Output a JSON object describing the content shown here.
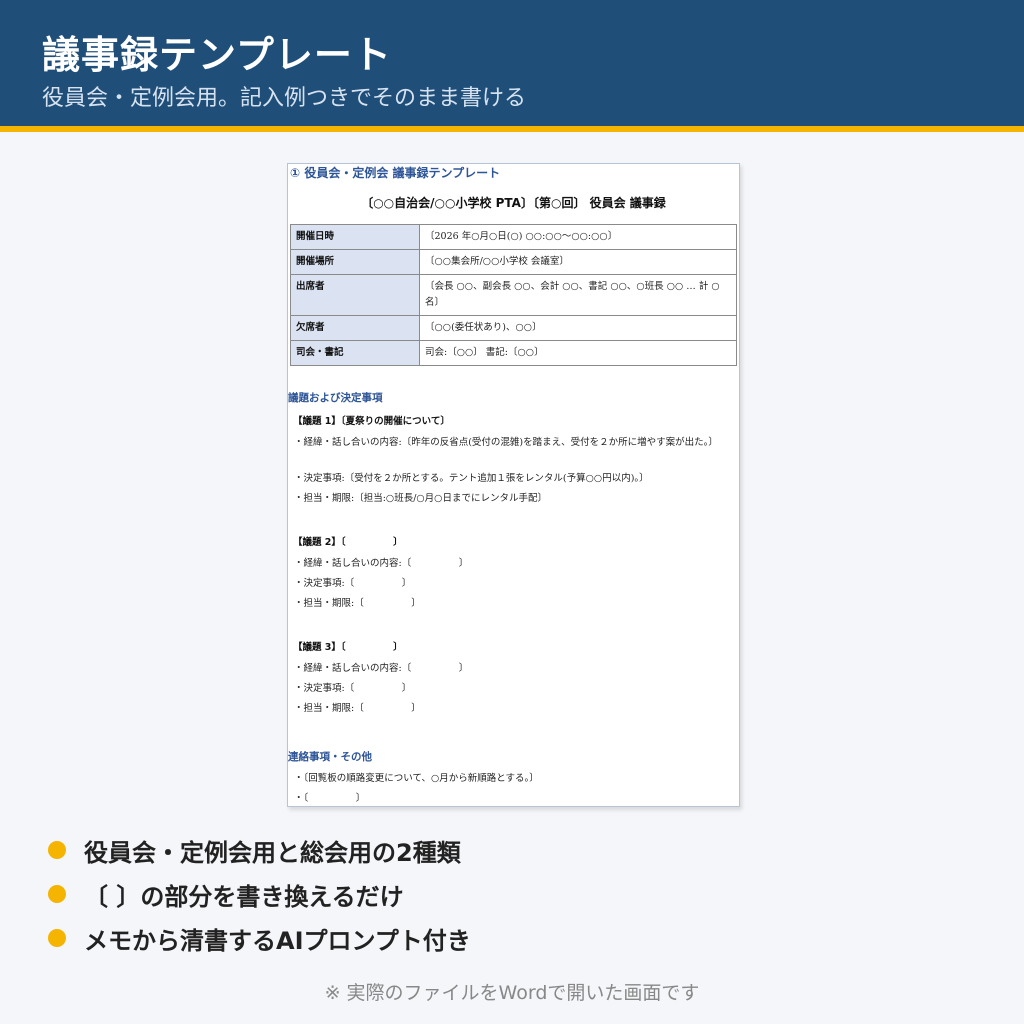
{
  "header": {
    "title": "議事録テンプレート",
    "subtitle": "役員会・定例会用。記入例つきでそのまま書ける"
  },
  "document": {
    "heading": "① 役員会・定例会 議事録テンプレート",
    "title": "〔○○自治会/○○小学校 PTA〕〔第○回〕 役員会 議事録",
    "meta": [
      {
        "key": "開催日時",
        "value": "〔2026 年○月○日(○) ○○:○○〜○○:○○〕"
      },
      {
        "key": "開催場所",
        "value": "〔○○集会所/○○小学校 会議室〕"
      },
      {
        "key": "出席者",
        "value": "〔会長 ○○、副会長 ○○、会計 ○○、書記 ○○、○班長 ○○ … 計 ○名〕"
      },
      {
        "key": "欠席者",
        "value": "〔○○(委任状あり)、○○〕"
      },
      {
        "key": "司会・書記",
        "value": "司会:〔○○〕 書記:〔○○〕"
      }
    ],
    "agenda_heading": "議題および決定事項",
    "agenda": [
      {
        "title": "【議題 1】〔夏祭りの開催について〕",
        "lines": [
          "・経緯・話し合いの内容:〔昨年の反省点(受付の混雑)を踏まえ、受付を２か所に増やす案が出た。〕",
          "・決定事項:〔受付を２か所とする。テント追加１張をレンタル(予算○○円以内)。〕",
          "・担当・期限:〔担当:○班長/○月○日までにレンタル手配〕"
        ]
      },
      {
        "title": "【議題 2】〔　　　　　〕",
        "lines": [
          "・経緯・話し合いの内容:〔　　　　　〕",
          "・決定事項:〔　　　　　〕",
          "・担当・期限:〔　　　　　〕"
        ]
      },
      {
        "title": "【議題 3】〔　　　　　〕",
        "lines": [
          "・経緯・話し合いの内容:〔　　　　　〕",
          "・決定事項:〔　　　　　〕",
          "・担当・期限:〔　　　　　〕"
        ]
      }
    ],
    "notes_heading": "連絡事項・その他",
    "notes": [
      "・〔回覧板の順路変更について、○月から新順路とする。〕",
      "・〔　　　　　〕"
    ]
  },
  "features": [
    "役員会・定例会用と総会用の2種類",
    "〔 〕の部分を書き換えるだけ",
    "メモから清書するAIプロンプト付き"
  ],
  "footnote": "※ 実際のファイルをWordで開いた画面です",
  "colors": {
    "header_bg": "#1f4e79",
    "accent": "#f4b400",
    "doc_heading": "#2e5597",
    "table_key_bg": "#dbe3f3"
  }
}
